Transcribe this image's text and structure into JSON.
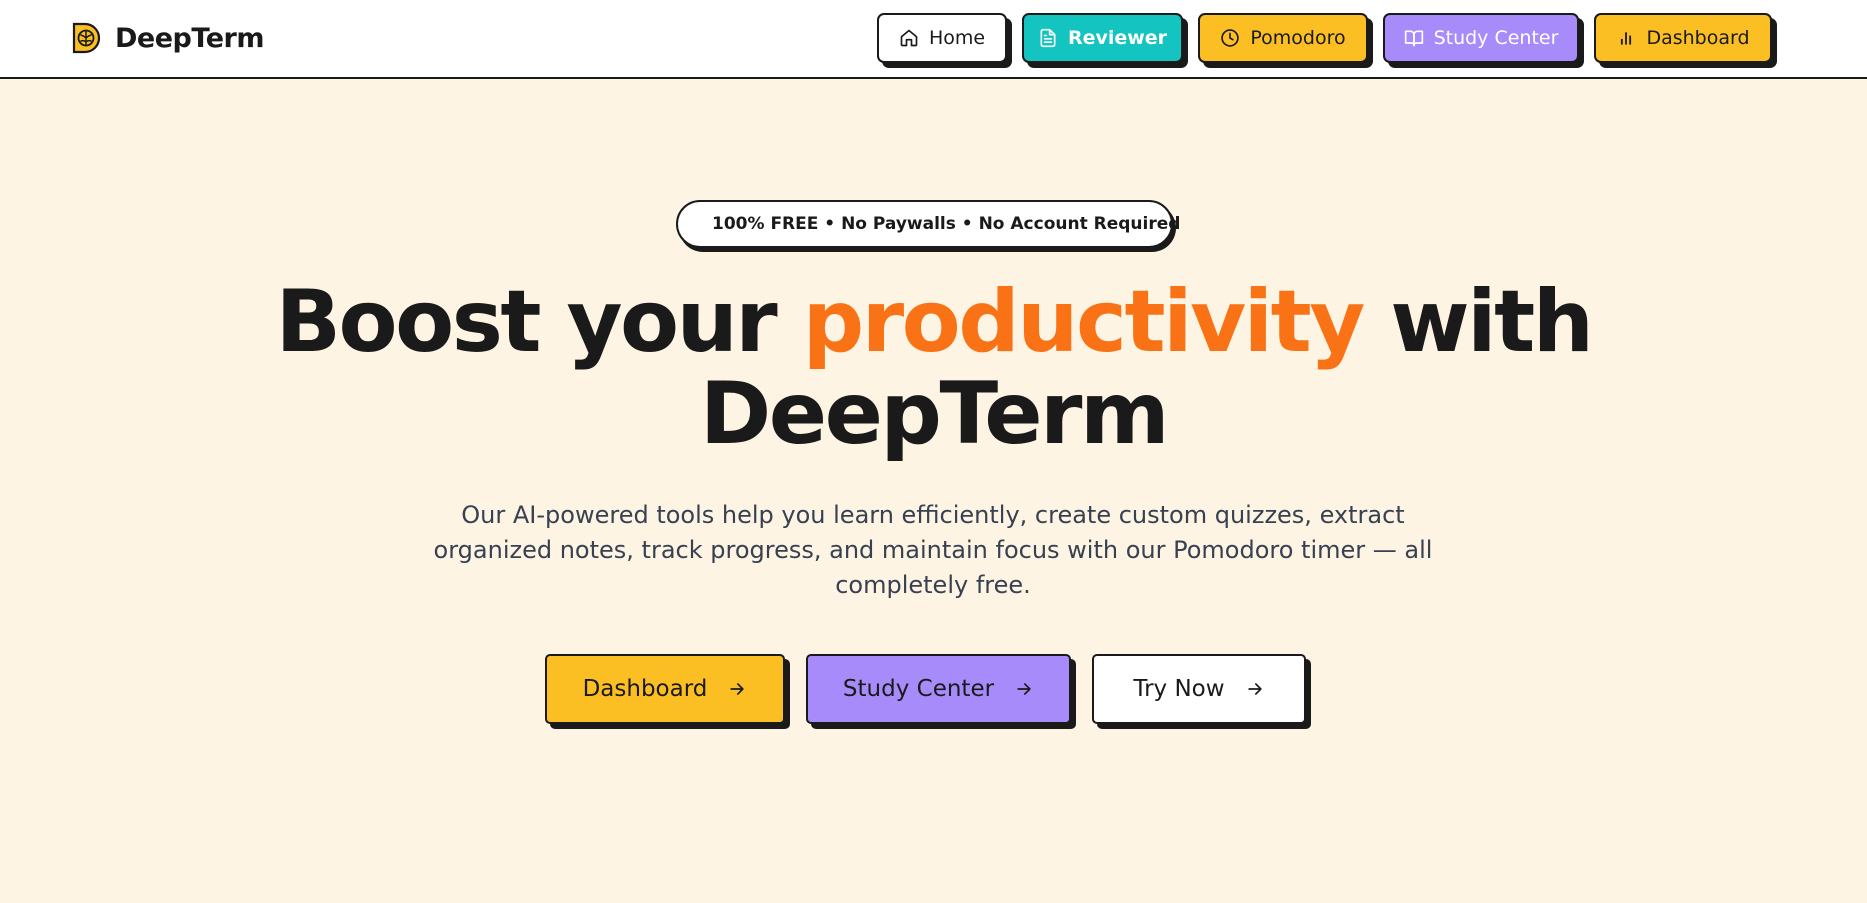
{
  "brand": {
    "name": "DeepTerm"
  },
  "nav": {
    "home": "Home",
    "reviewer": "Reviewer",
    "pomodoro": "Pomodoro",
    "study_center": "Study Center",
    "dashboard": "Dashboard"
  },
  "badge": {
    "text": "100% FREE • No Paywalls • No Account Required"
  },
  "hero": {
    "title_part1": "Boost your ",
    "title_accent": "productivity",
    "title_part2": " with",
    "title_line2": "DeepTerm",
    "subtitle": "Our AI-powered tools help you learn efficiently, create custom quizzes, extract organized notes, track progress, and maintain focus with our Pomodoro timer — all completely free."
  },
  "cta": {
    "dashboard": "Dashboard",
    "study_center": "Study Center",
    "try_now": "Try Now"
  },
  "colors": {
    "background": "#fef4e4",
    "accent_orange": "#f97316",
    "yellow": "#fbbf24",
    "teal": "#14c4c0",
    "purple": "#a78bfa",
    "ink": "#1a1a1a"
  },
  "icons": {
    "brand": "brain-logo-icon",
    "home": "home-icon",
    "reviewer": "document-icon",
    "pomodoro": "clock-icon",
    "study_center": "book-open-icon",
    "dashboard": "bar-chart-icon",
    "badge": "lightning-icon",
    "cta_arrow": "arrow-right-icon"
  }
}
